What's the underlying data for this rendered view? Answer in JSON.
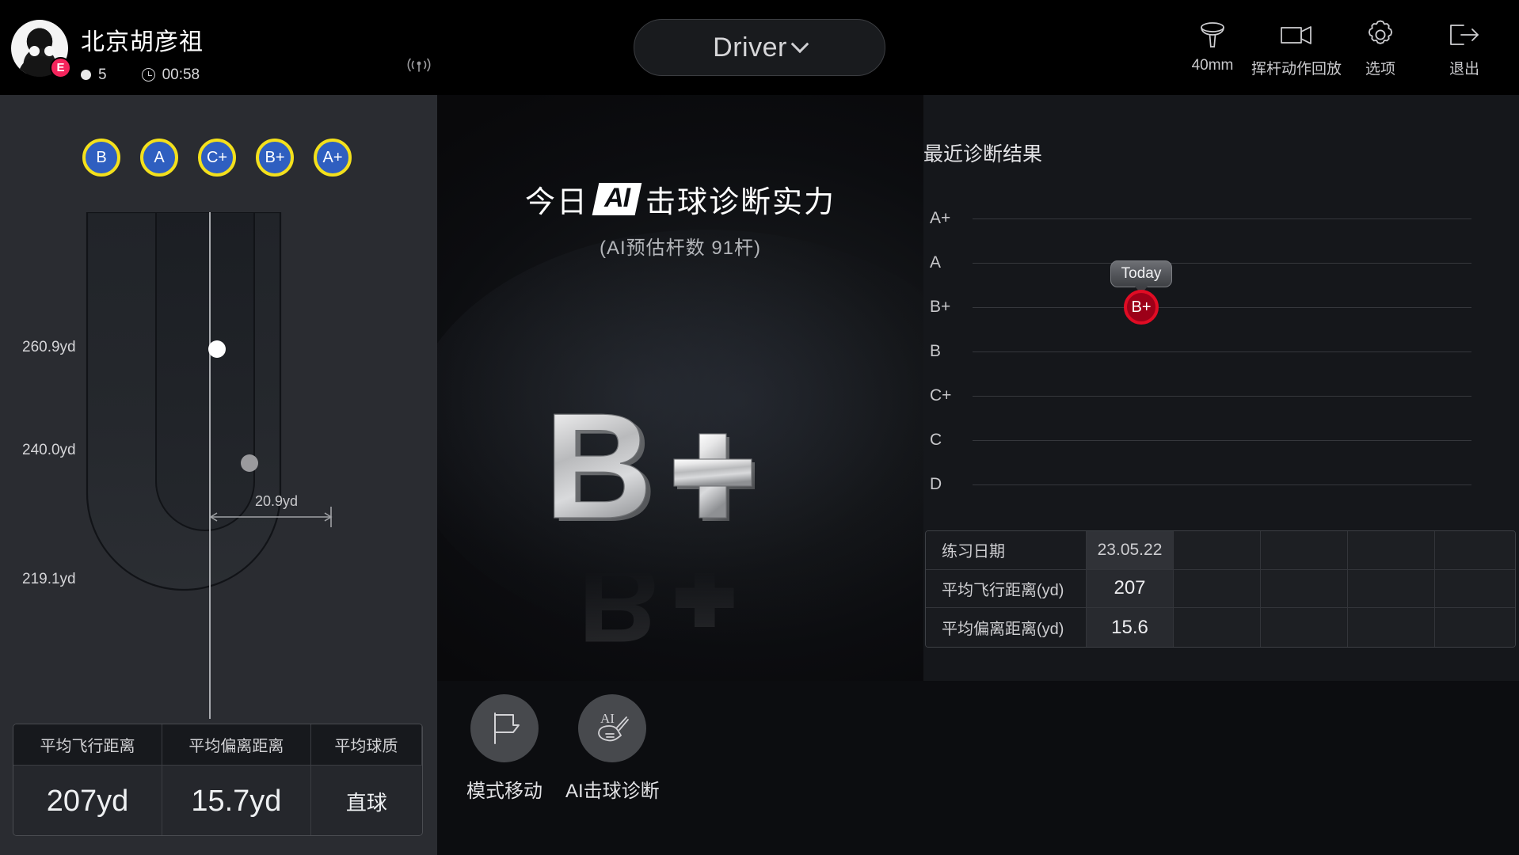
{
  "header": {
    "user_name": "北京胡彦祖",
    "level_badge": "E",
    "ball_count": "5",
    "timer": "00:58",
    "signal_icon": "broadcast-signal-icon",
    "club": {
      "label": "Driver",
      "chevron_icon": "chevron-down-icon"
    },
    "actions": [
      {
        "icon": "golf-tee-icon",
        "label": "40mm"
      },
      {
        "icon": "video-camera-icon",
        "label": "挥杆动作回放"
      },
      {
        "icon": "gear-icon",
        "label": "选项"
      },
      {
        "icon": "exit-arrow-icon",
        "label": "退出"
      }
    ]
  },
  "sidebar": {
    "grade_badges": [
      "B",
      "A",
      "C+",
      "B+",
      "A+"
    ],
    "dispersion": {
      "distance_labels": [
        "260.9yd",
        "240.0yd",
        "219.1yd"
      ],
      "lateral_label": "20.9yd",
      "current_shot_marker": "white-ball-marker",
      "previous_shot_marker": "gray-ball-marker"
    },
    "stats": {
      "headers": [
        "平均飞行距离",
        "平均偏离距离",
        "平均球质"
      ],
      "values": [
        "207yd",
        "15.7yd",
        "直球"
      ]
    }
  },
  "center": {
    "title_prefix": "今日",
    "ai_chip": "AI",
    "title_suffix": "击球诊断实力",
    "subtitle": "(AI预估杆数 91杆)",
    "grade_display": "B+"
  },
  "right": {
    "chart_title": "最近诊断结果",
    "table": {
      "rows": [
        {
          "label": "练习日期",
          "value": "23.05.22"
        },
        {
          "label": "平均飞行距离(yd)",
          "value": "207"
        },
        {
          "label": "平均偏离距离(yd)",
          "value": "15.6"
        }
      ],
      "empty_columns": 4
    }
  },
  "bottom": {
    "actions": [
      {
        "icon": "flag-pin-icon",
        "label": "模式移动"
      },
      {
        "icon": "ai-driver-club-icon",
        "label": "AI击球诊断"
      }
    ]
  },
  "colors": {
    "accent_red": "#e00c24",
    "badge_pink": "#f5245c",
    "grade_ring_yellow": "#f3e01c",
    "grade_fill_blue": "#2f5fc0",
    "panel_bg": "#15171b",
    "sidebar_bg": "#2a2c31"
  },
  "chart_data": {
    "type": "scatter",
    "title": "最近诊断结果",
    "xlabel": "",
    "ylabel": "",
    "categories": [
      "A+",
      "A",
      "B+",
      "B",
      "C+",
      "C",
      "D"
    ],
    "y_tick_labels": [
      "A+",
      "A",
      "B+",
      "B",
      "C+",
      "C",
      "D"
    ],
    "grid": true,
    "legend_position": "none",
    "series": [
      {
        "name": "Today",
        "points": [
          {
            "x": "23.05.22",
            "y": "B+",
            "label": "B+",
            "annotation": "Today"
          }
        ]
      }
    ],
    "table": {
      "row_labels": [
        "练习日期",
        "平均飞行距离(yd)",
        "平均偏离距离(yd)"
      ],
      "columns": [
        [
          "23.05.22",
          "207",
          "15.6"
        ],
        [
          "",
          "",
          ""
        ],
        [
          "",
          "",
          ""
        ],
        [
          "",
          "",
          ""
        ],
        [
          "",
          "",
          ""
        ]
      ]
    }
  }
}
